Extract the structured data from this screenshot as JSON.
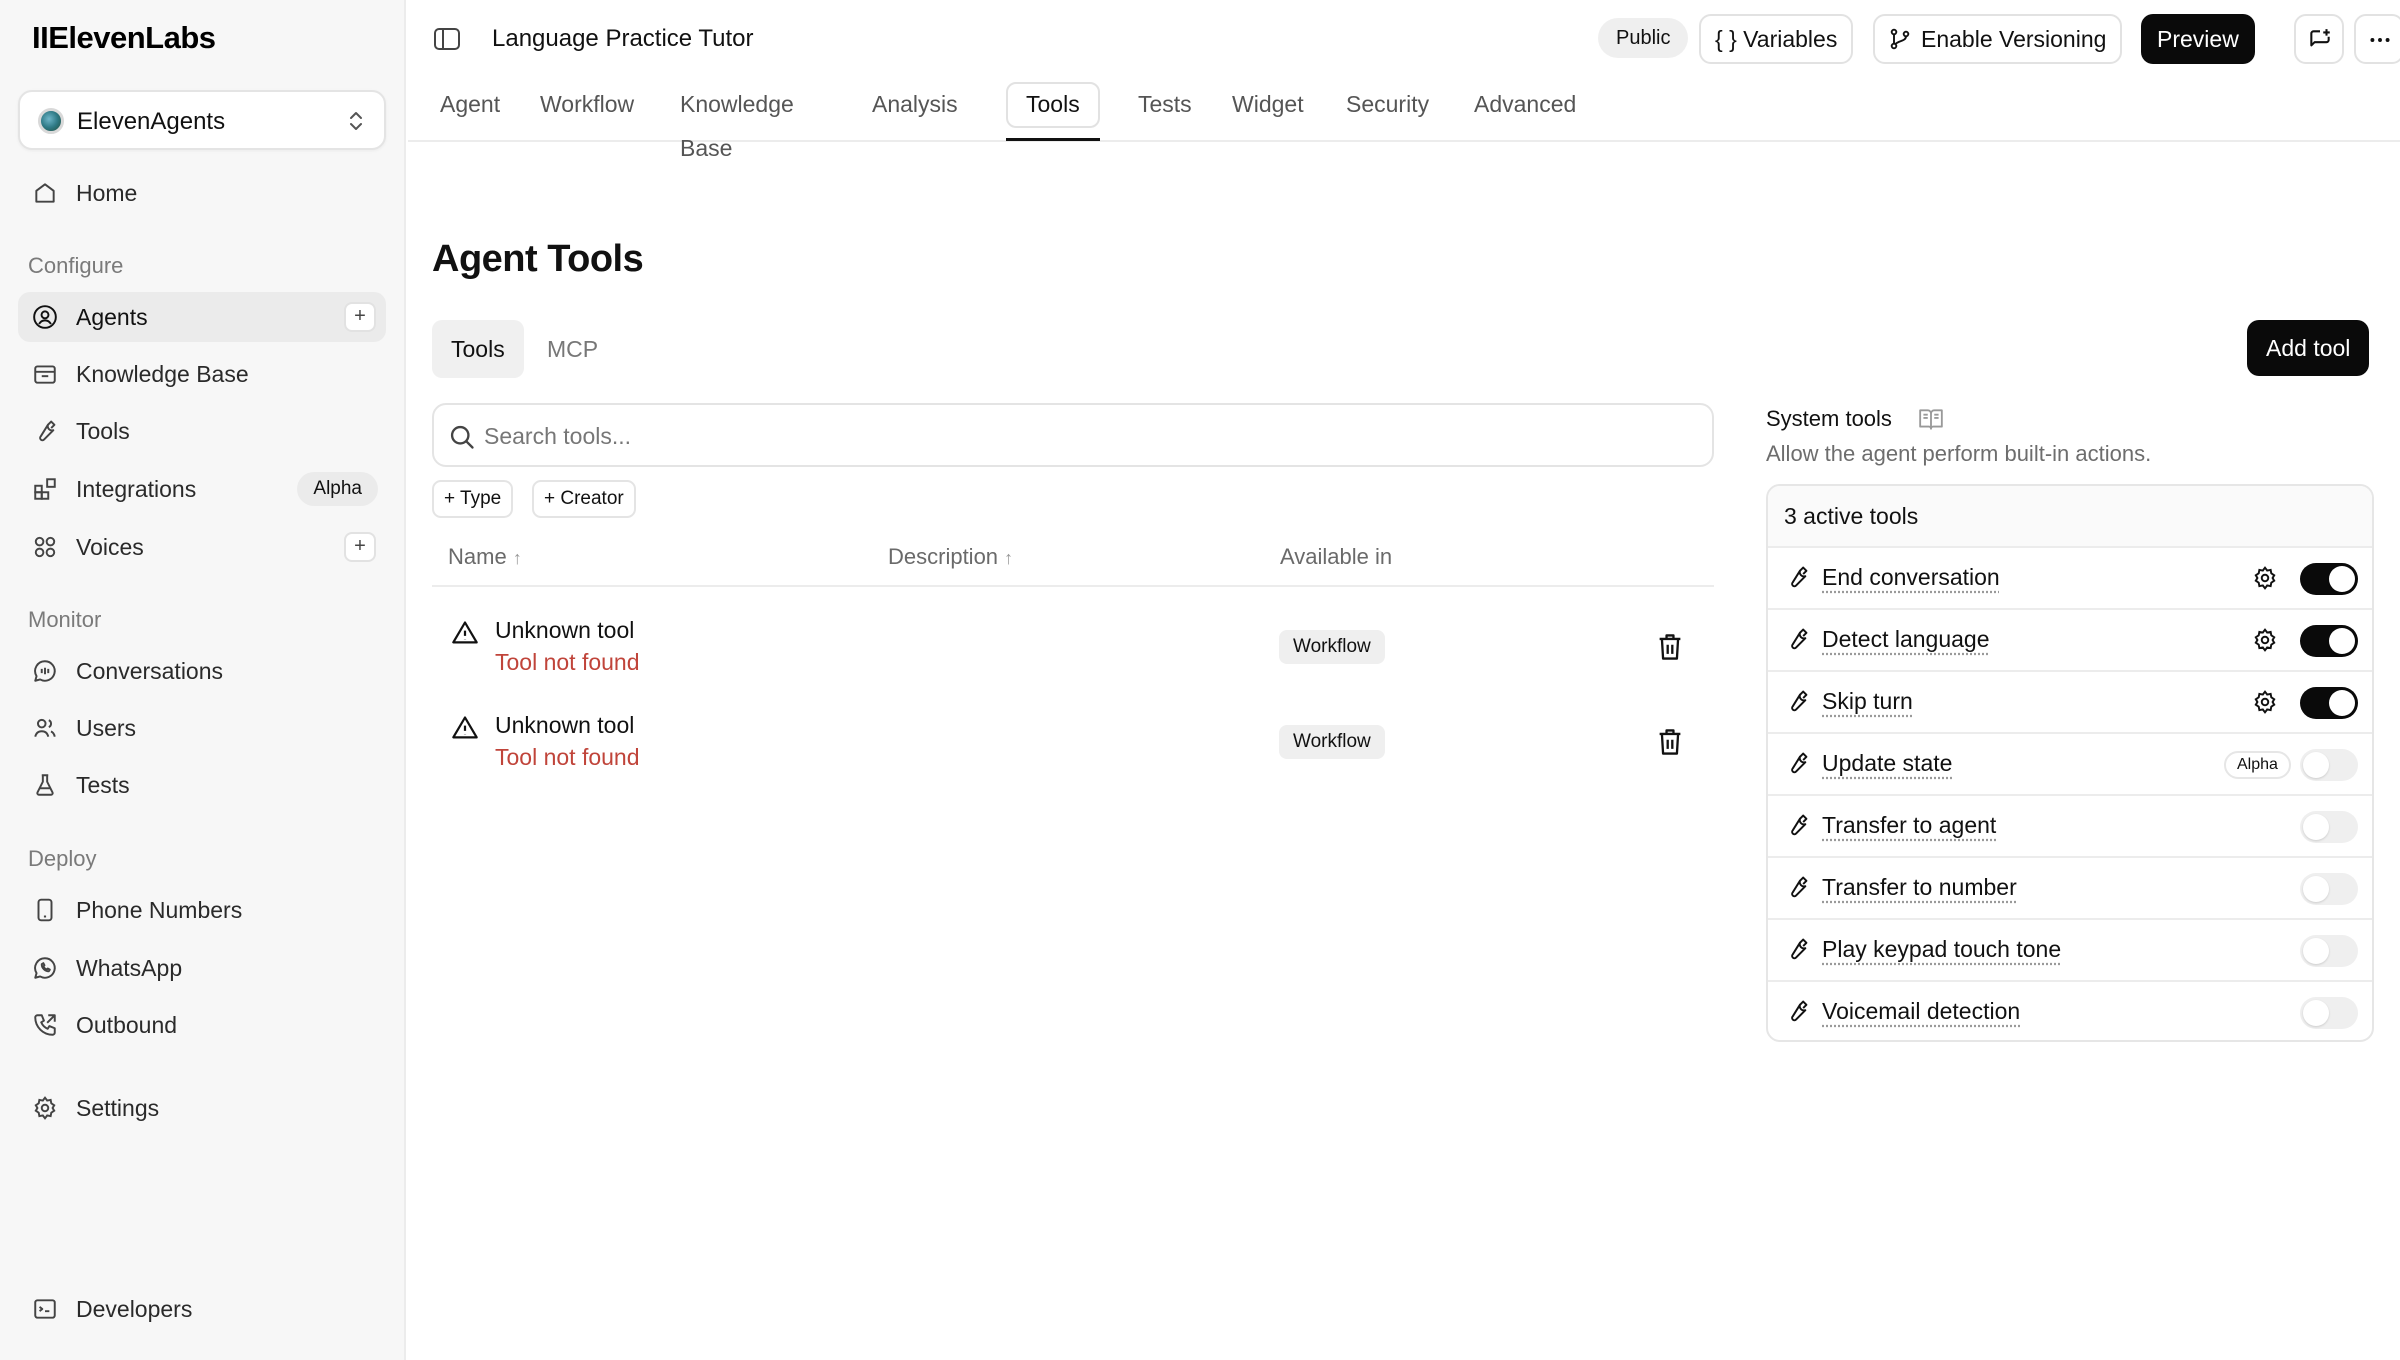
{
  "sidebar": {
    "logo": "IIElevenLabs",
    "workspace": "ElevenAgents",
    "home": "Home",
    "sections": {
      "configure": "Configure",
      "monitor": "Monitor",
      "deploy": "Deploy"
    },
    "configure_items": {
      "agents": "Agents",
      "knowledge_base": "Knowledge Base",
      "tools": "Tools",
      "integrations": "Integrations",
      "integrations_badge": "Alpha",
      "voices": "Voices"
    },
    "monitor_items": {
      "conversations": "Conversations",
      "users": "Users",
      "tests": "Tests"
    },
    "deploy_items": {
      "phone_numbers": "Phone Numbers",
      "whatsapp": "WhatsApp",
      "outbound": "Outbound"
    },
    "settings": "Settings",
    "developers": "Developers",
    "plus": "+"
  },
  "header": {
    "agent_name": "Language Practice Tutor",
    "public": "Public",
    "variables": "{ } Variables",
    "enable_versioning": "Enable Versioning",
    "preview": "Preview",
    "tabs": [
      "Agent",
      "Workflow",
      "Knowledge Base",
      "Analysis",
      "Tools",
      "Tests",
      "Widget",
      "Security",
      "Advanced"
    ],
    "active_tab": "Tools"
  },
  "main": {
    "title": "Agent Tools",
    "segments": [
      "Tools",
      "MCP"
    ],
    "add_tool": "Add tool",
    "search_placeholder": "Search tools...",
    "filters": [
      "Type",
      "Creator"
    ],
    "columns": {
      "name": "Name",
      "description": "Description",
      "available_in": "Available in"
    },
    "rows": [
      {
        "name": "Unknown tool",
        "error": "Tool not found",
        "available_in": "Workflow"
      },
      {
        "name": "Unknown tool",
        "error": "Tool not found",
        "available_in": "Workflow"
      }
    ]
  },
  "system_tools": {
    "title": "System tools",
    "subtitle": "Allow the agent perform built-in actions.",
    "active_count": "3 active tools",
    "items": [
      {
        "name": "End conversation",
        "enabled": true,
        "has_settings": true
      },
      {
        "name": "Detect language",
        "enabled": true,
        "has_settings": true
      },
      {
        "name": "Skip turn",
        "enabled": true,
        "has_settings": true
      },
      {
        "name": "Update state",
        "enabled": false,
        "badge": "Alpha"
      },
      {
        "name": "Transfer to agent",
        "enabled": false
      },
      {
        "name": "Transfer to number",
        "enabled": false
      },
      {
        "name": "Play keypad touch tone",
        "enabled": false
      },
      {
        "name": "Voicemail detection",
        "enabled": false
      }
    ]
  },
  "colors": {
    "accent": "#0a0a0a",
    "error": "#c0443a",
    "sidebar_bg": "#f7f7f7"
  }
}
